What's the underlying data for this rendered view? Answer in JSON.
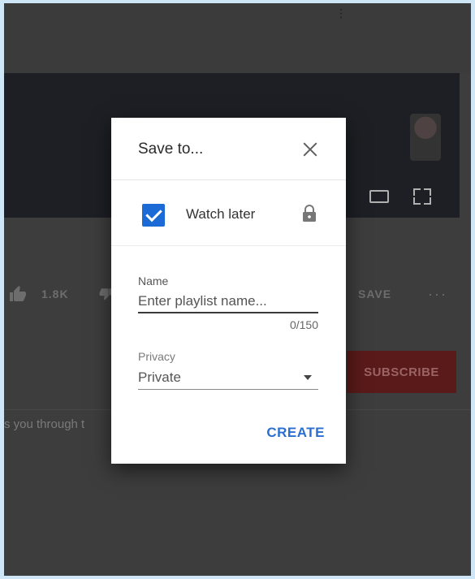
{
  "background_page": {
    "top_dots": "⋮",
    "like_count": "1.8K",
    "save_label": "SAVE",
    "more_label": "···",
    "subscribe_label": "SUBSCRIBE",
    "description_fragment": "s you through t"
  },
  "dialog": {
    "title": "Save to...",
    "watch_later_label": "Watch later",
    "watch_later_checked": true,
    "name_label": "Name",
    "name_placeholder": "Enter playlist name...",
    "char_counter": "0/150",
    "privacy_label": "Privacy",
    "privacy_value": "Private",
    "create_label": "CREATE"
  },
  "icons": {
    "close": "close-icon",
    "lock": "lock-icon",
    "like": "thumbs-up-icon",
    "caret": "caret-down-icon"
  },
  "colors": {
    "accent_blue": "#2a6fd1",
    "checkbox_blue": "#1b6ad6",
    "subscribe_red": "#5a1a1a",
    "backdrop": "#3d3d3d"
  }
}
